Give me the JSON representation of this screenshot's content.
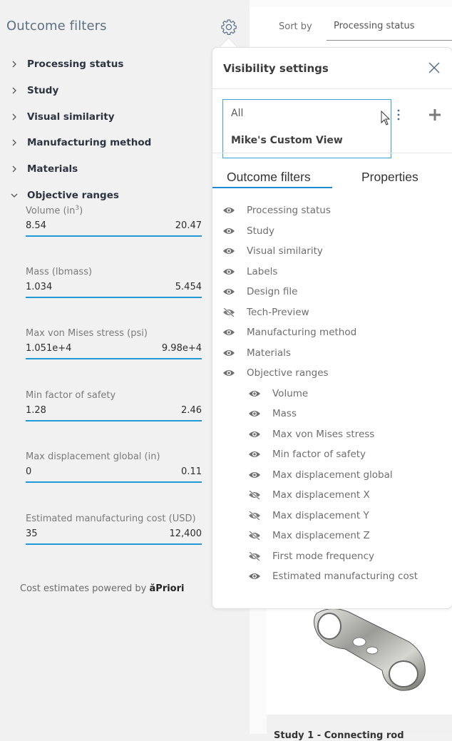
{
  "sidebar": {
    "title": "Outcome filters",
    "settings_icon": "gear-icon",
    "filters": [
      {
        "label": "Processing status",
        "expanded": false
      },
      {
        "label": "Study",
        "expanded": false
      },
      {
        "label": "Visual similarity",
        "expanded": false
      },
      {
        "label": "Manufacturing method",
        "expanded": false
      },
      {
        "label": "Materials",
        "expanded": false
      },
      {
        "label": "Objective ranges",
        "expanded": true
      }
    ],
    "ranges": [
      {
        "label": "Volume (in",
        "sup": "3",
        "label_suffix": ")",
        "min": "8.54",
        "max": "20.47"
      },
      {
        "label": "Mass (lbmass)",
        "min": "1.034",
        "max": "5.454"
      },
      {
        "label": "Max von Mises stress (psi)",
        "min": "1.051e+4",
        "max": "9.98e+4"
      },
      {
        "label": "Min factor of safety",
        "min": "1.28",
        "max": "2.46"
      },
      {
        "label": "Max displacement global (in)",
        "min": "0",
        "max": "0.11"
      },
      {
        "label": "Estimated manufacturing cost (USD)",
        "min": "35",
        "max": "12,400"
      }
    ],
    "powered_by": "Cost estimates powered by",
    "powered_brand": "ăPriori"
  },
  "topbar": {
    "sort_label": "Sort by",
    "sort_value": "Processing status"
  },
  "card": {
    "footer_text": "Study 1 - Connecting rod"
  },
  "popover": {
    "title": "Visibility settings",
    "views": [
      "All",
      "Mike's Custom View"
    ],
    "tabs": [
      "Outcome filters",
      "Properties"
    ],
    "active_tab": "Outcome filters",
    "items": [
      {
        "label": "Processing status",
        "visible": true,
        "level": 0
      },
      {
        "label": "Study",
        "visible": true,
        "level": 0
      },
      {
        "label": "Visual similarity",
        "visible": true,
        "level": 0
      },
      {
        "label": "Labels",
        "visible": true,
        "level": 0
      },
      {
        "label": "Design file",
        "visible": true,
        "level": 0
      },
      {
        "label": "Tech-Preview",
        "visible": false,
        "level": 0
      },
      {
        "label": "Manufacturing method",
        "visible": true,
        "level": 0
      },
      {
        "label": "Materials",
        "visible": true,
        "level": 0
      },
      {
        "label": "Objective ranges",
        "visible": true,
        "level": 0
      },
      {
        "label": "Volume",
        "visible": true,
        "level": 1
      },
      {
        "label": "Mass",
        "visible": true,
        "level": 1
      },
      {
        "label": "Max von Mises stress",
        "visible": true,
        "level": 1
      },
      {
        "label": "Min factor of safety",
        "visible": true,
        "level": 1
      },
      {
        "label": "Max displacement global",
        "visible": true,
        "level": 1
      },
      {
        "label": "Max displacement X",
        "visible": false,
        "level": 1
      },
      {
        "label": "Max displacement Y",
        "visible": false,
        "level": 1
      },
      {
        "label": "Max displacement Z",
        "visible": false,
        "level": 1
      },
      {
        "label": "First mode frequency",
        "visible": false,
        "level": 1
      },
      {
        "label": "Estimated manufacturing cost",
        "visible": true,
        "level": 1
      }
    ]
  },
  "colors": {
    "accent": "#1f9ad6",
    "title_blue_gray": "#5d6f80",
    "icon_gray": "#707070"
  }
}
